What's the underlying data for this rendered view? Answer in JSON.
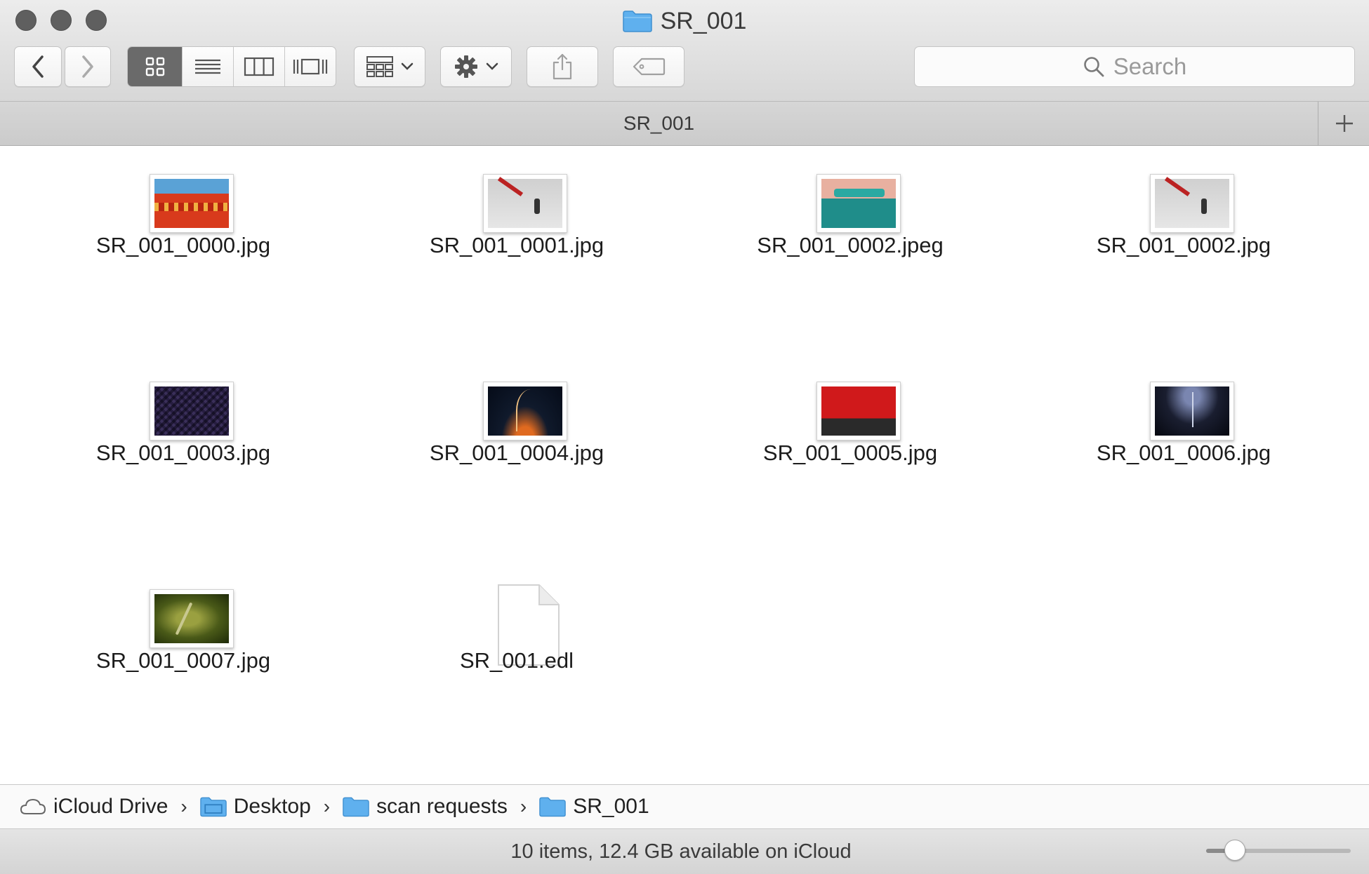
{
  "window": {
    "title": "SR_001",
    "title_icon": "folder-icon"
  },
  "toolbar": {
    "back_icon": "chevron-left-icon",
    "forward_icon": "chevron-right-icon",
    "view_modes": [
      {
        "name": "icon-view",
        "icon": "grid-icon",
        "selected": true
      },
      {
        "name": "list-view",
        "icon": "list-icon",
        "selected": false
      },
      {
        "name": "column-view",
        "icon": "columns-icon",
        "selected": false
      },
      {
        "name": "cover-flow-view",
        "icon": "cover-flow-icon",
        "selected": false
      }
    ],
    "arrange_icon": "arrange-grid-icon",
    "action_icon": "gear-icon",
    "share_icon": "share-icon",
    "tag_icon": "tag-icon",
    "search_placeholder": "Search"
  },
  "tabbar": {
    "tab_label": "SR_001",
    "add_icon": "plus-icon"
  },
  "files": [
    {
      "name": "SR_001_0000.jpg",
      "kind": "image"
    },
    {
      "name": "SR_001_0001.jpg",
      "kind": "image"
    },
    {
      "name": "SR_001_0002.jpeg",
      "kind": "image"
    },
    {
      "name": "SR_001_0002.jpg",
      "kind": "image"
    },
    {
      "name": "SR_001_0003.jpg",
      "kind": "image"
    },
    {
      "name": "SR_001_0004.jpg",
      "kind": "image"
    },
    {
      "name": "SR_001_0005.jpg",
      "kind": "image"
    },
    {
      "name": "SR_001_0006.jpg",
      "kind": "image"
    },
    {
      "name": "SR_001_0007.jpg",
      "kind": "image"
    },
    {
      "name": "SR_001.edl",
      "kind": "document"
    }
  ],
  "pathbar": {
    "items": [
      {
        "label": "iCloud Drive",
        "icon": "cloud-icon"
      },
      {
        "label": "Desktop",
        "icon": "folder-icon"
      },
      {
        "label": "scan requests",
        "icon": "folder-icon"
      },
      {
        "label": "SR_001",
        "icon": "folder-icon"
      }
    ]
  },
  "status": {
    "text": "10 items, 12.4 GB available on iCloud",
    "icon_size_fraction": 0.2
  },
  "colors": {
    "folder_blue": "#5fb0ee",
    "selected_segment": "#6a6a6a"
  }
}
